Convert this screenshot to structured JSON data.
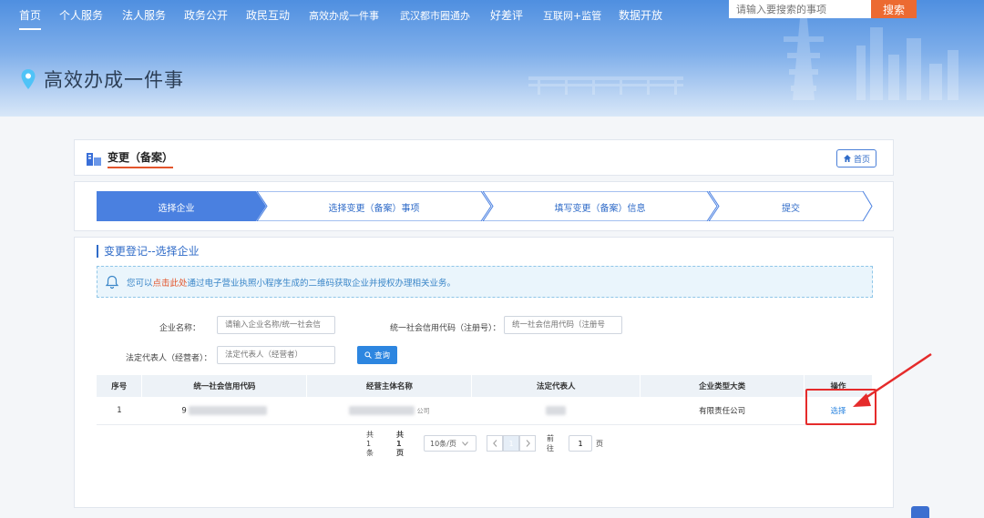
{
  "nav": {
    "items": [
      {
        "label": "首页",
        "active": true
      },
      {
        "label": "个人服务"
      },
      {
        "label": "法人服务"
      },
      {
        "label": "政务公开"
      },
      {
        "label": "政民互动"
      },
      {
        "label": "高效办成一件事"
      },
      {
        "label": "武汉都市圈通办"
      },
      {
        "label": "好差评"
      },
      {
        "label": "互联网+监管"
      },
      {
        "label": "数据开放"
      }
    ],
    "search_placeholder": "请输入要搜索的事项",
    "search_button": "搜索"
  },
  "page_heading": "高效办成一件事",
  "section": {
    "title": "变更（备案）",
    "home_button": "首页"
  },
  "steps": [
    {
      "label": "选择企业",
      "active": true
    },
    {
      "label": "选择变更（备案）事项"
    },
    {
      "label": "填写变更（备案）信息"
    },
    {
      "label": "提交"
    }
  ],
  "form": {
    "sub_title": "变更登记--选择企业",
    "notice": {
      "prefix": "您可以",
      "link": "点击此处",
      "suffix": "通过电子营业执照小程序生成的二维码获取企业并授权办理相关业务。"
    },
    "company_name_label": "企业名称：",
    "company_name_placeholder": "请输入企业名称/统一社会信",
    "credit_code_label": "统一社会信用代码（注册号）：",
    "credit_code_placeholder": "统一社会信用代码（注册号",
    "legal_rep_label": "法定代表人（经营者）：",
    "legal_rep_placeholder": "法定代表人（经营者）",
    "query_button": "查询"
  },
  "table": {
    "headers": [
      "序号",
      "统一社会信用代码",
      "经营主体名称",
      "法定代表人",
      "企业类型大类",
      "操作"
    ],
    "rows": [
      {
        "index": "1",
        "credit_code": "9",
        "name_suffix": "公司",
        "legal_rep": "",
        "type": "有限责任公司",
        "action": "选择"
      }
    ]
  },
  "pagination": {
    "total": "共 1 条",
    "pages": "共1页",
    "page_size": "10条/页",
    "current_page": "1",
    "goto_label": "前往",
    "goto_value": "1",
    "page_unit": "页"
  }
}
